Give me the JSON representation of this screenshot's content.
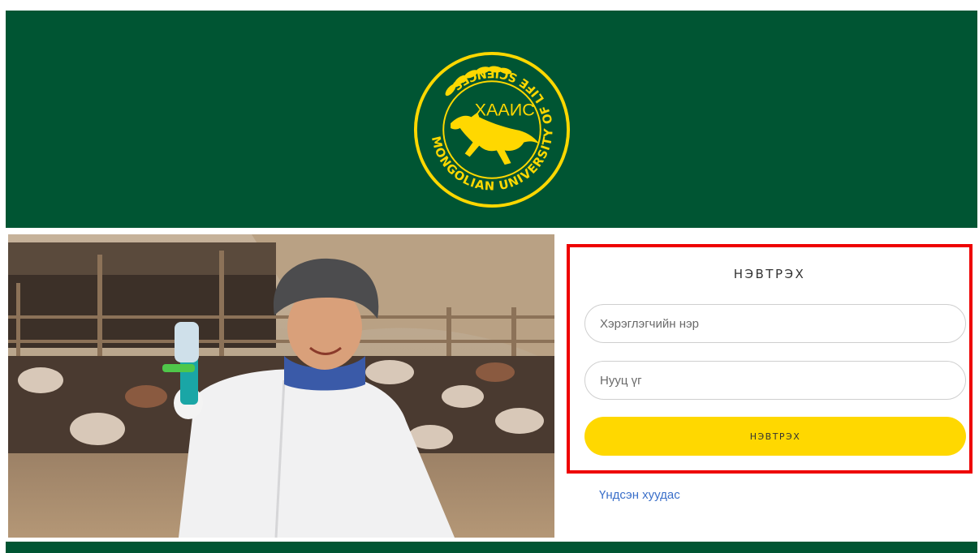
{
  "logo": {
    "name_mn": "ХААИС",
    "name_en": "MONGOLIAN UNIVERSITY OF LIFE SCIENCES"
  },
  "login": {
    "title": "НЭВТРЭХ",
    "username_placeholder": "Хэрэглэгчийн нэр",
    "password_placeholder": "Нууц үг",
    "submit_label": "НЭВТРЭХ"
  },
  "links": {
    "home": "Үндсэн хуудас"
  },
  "colors": {
    "brand_green": "#005533",
    "brand_yellow": "#ffd800",
    "highlight_red": "#ee0000",
    "link_blue": "#3a6fc9"
  }
}
